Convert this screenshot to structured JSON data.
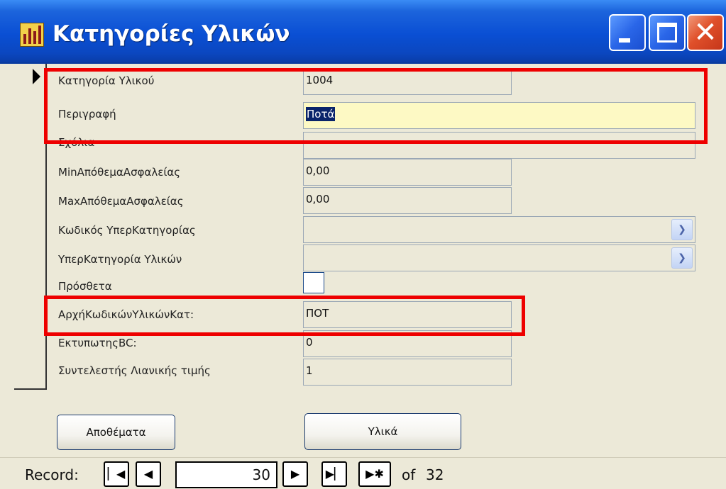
{
  "window": {
    "title": "Κατηγορίες Υλικών",
    "icon": "chart-app-icon",
    "controls": {
      "minimize": "minimize-icon",
      "maximize": "maximize-icon",
      "close": "close-icon",
      "close_glyph": "✕"
    }
  },
  "form": {
    "fields": [
      {
        "label": "Κατηγορία Υλικού",
        "value": "1004"
      },
      {
        "label": "Περιγραφή",
        "value": "Ποτά"
      },
      {
        "label": "Σχόλια",
        "value": ""
      },
      {
        "label": "MinΑπόθεμαΑσφαλείας",
        "value": "0,00"
      },
      {
        "label": "MaxΑπόθεμαΑσφαλείας",
        "value": "0,00"
      },
      {
        "label": "Κωδικός ΥπερΚατηγορίας",
        "value": ""
      },
      {
        "label": "ΥπερΚατηγορία Υλικών",
        "value": ""
      },
      {
        "label": "Πρόσθετα",
        "checked": false
      },
      {
        "label": "ΑρχήΚωδικώνΥλικώνΚατ:",
        "value": "ΠΟΤ"
      },
      {
        "label": "ΕκτυπωτηςBC:",
        "value": "0"
      },
      {
        "label": "Συντελεστής Λιανικής τιμής",
        "value": "1"
      }
    ],
    "buttons": {
      "stock": "Αποθέματα",
      "materials": "Υλικά"
    },
    "highlight_color": "#ee0000",
    "active_field_color": "#fdf9c4"
  },
  "navigation": {
    "label": "Record:",
    "current": "30",
    "of_label": "of",
    "total": "32",
    "buttons": {
      "first": "▏◀",
      "prev": "◀",
      "next": "▶",
      "last": "▶▏",
      "new": "▶✱"
    }
  }
}
